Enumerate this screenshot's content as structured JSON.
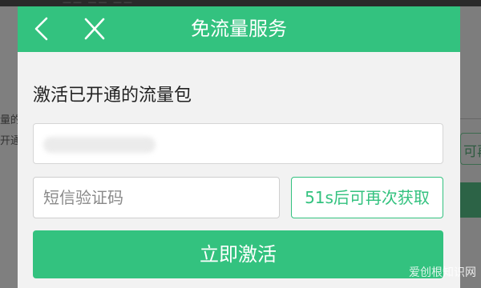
{
  "background_page": {
    "top_text": "—— —— ——",
    "left_text_1": "量的",
    "left_text_2": "开通",
    "right_button_label": "可再"
  },
  "dialog": {
    "title": "免流量服务",
    "section_title": "激活已开通的流量包",
    "code_input": {
      "placeholder": "短信验证码",
      "value": ""
    },
    "resend_label": "51s后可再次获取",
    "activate_label": "立即激活"
  },
  "watermark": "爱创根知识网",
  "colors": {
    "accent_green": "#33c27f",
    "dialog_background": "#f2f2f2",
    "overlay": "#7d7d7d"
  },
  "icons": {
    "back": "back-arrow-icon",
    "close": "close-icon"
  }
}
